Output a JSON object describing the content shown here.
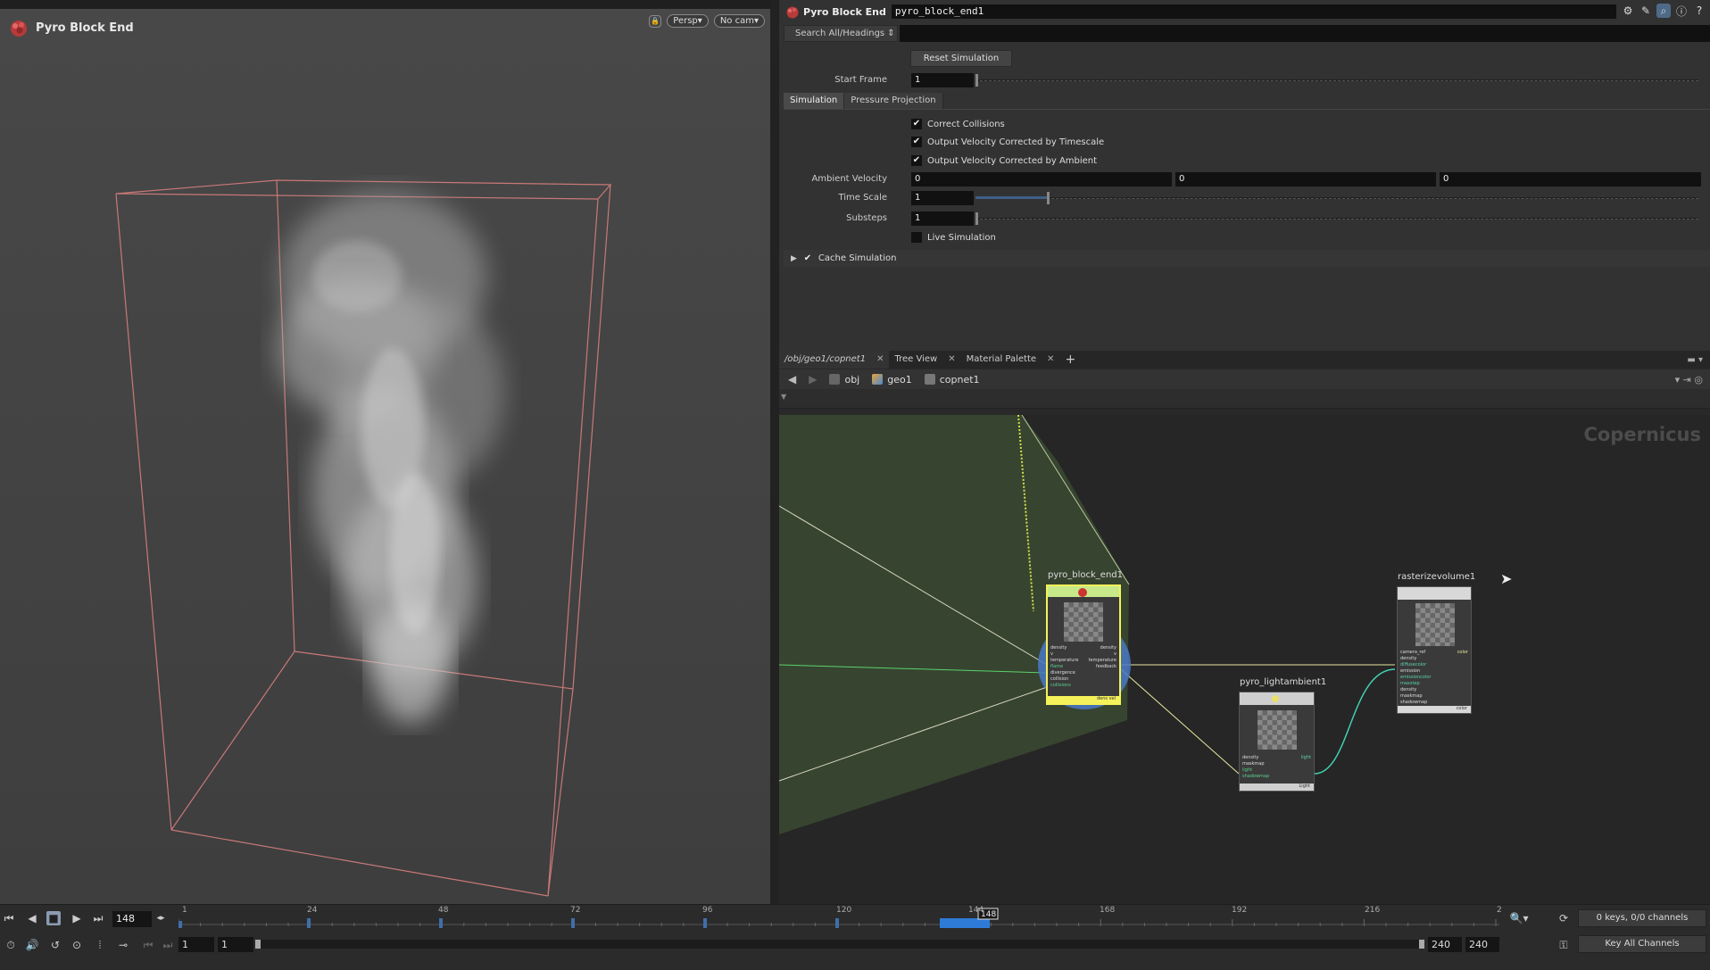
{
  "viewport": {
    "title": "Pyro Block End",
    "camera_menu": "Persp",
    "cam_menu": "No cam"
  },
  "params": {
    "node_type": "Pyro Block End",
    "node_name": "pyro_block_end1",
    "search_label": "Search All/Headings",
    "reset_label": "Reset Simulation",
    "start_frame_label": "Start Frame",
    "start_frame_value": "1",
    "tabs": [
      "Simulation",
      "Pressure Projection"
    ],
    "checks": [
      {
        "label": "Correct Collisions",
        "checked": true
      },
      {
        "label": "Output Velocity Corrected by Timescale",
        "checked": true
      },
      {
        "label": "Output Velocity Corrected by Ambient",
        "checked": true
      }
    ],
    "ambient_label": "Ambient Velocity",
    "ambient_values": [
      "0",
      "0",
      "0"
    ],
    "timescale_label": "Time Scale",
    "timescale_value": "1",
    "substeps_label": "Substeps",
    "substeps_value": "1",
    "live_label": "Live Simulation",
    "live_checked": false,
    "cache_label": "Cache Simulation"
  },
  "network": {
    "tabs": [
      "/obj/geo1/copnet1",
      "Tree View",
      "Material Palette"
    ],
    "path": [
      "obj",
      "geo1",
      "copnet1"
    ],
    "context_label": "Copernicus",
    "nodes": {
      "pyro_block_end": {
        "name": "pyro_block_end1",
        "inputs": [
          "density",
          "v",
          "temperature",
          "flame",
          "divergence",
          "collision",
          "collisions"
        ],
        "outputs": [
          "density",
          "v",
          "temperature",
          "feedback"
        ],
        "footer": "dens vel"
      },
      "lightambient": {
        "name": "pyro_lightambient1",
        "inputs": [
          "density",
          "maskmap",
          "light",
          "shadowmap"
        ],
        "outputs": [
          "light"
        ],
        "footer": "Light"
      },
      "rasterize": {
        "name": "rasterizevolume1",
        "inputs": [
          "camera_ref",
          "density",
          "diffusecolor",
          "emission",
          "emissioncolor",
          "maxstep",
          "density",
          "maskmap",
          "shadowmap"
        ],
        "outputs": [
          "color"
        ],
        "footer": "color"
      }
    }
  },
  "timeline": {
    "current_frame": "148",
    "tick_labels": [
      "1",
      "24",
      "48",
      "72",
      "96",
      "120",
      "144",
      "168",
      "192",
      "216",
      "2"
    ],
    "start_value": "1",
    "start_value2": "1",
    "end_value": "240",
    "end_value2": "240",
    "keys_label": "0 keys, 0/0 channels",
    "key_all_label": "Key All Channels",
    "playhead_label": "148"
  }
}
